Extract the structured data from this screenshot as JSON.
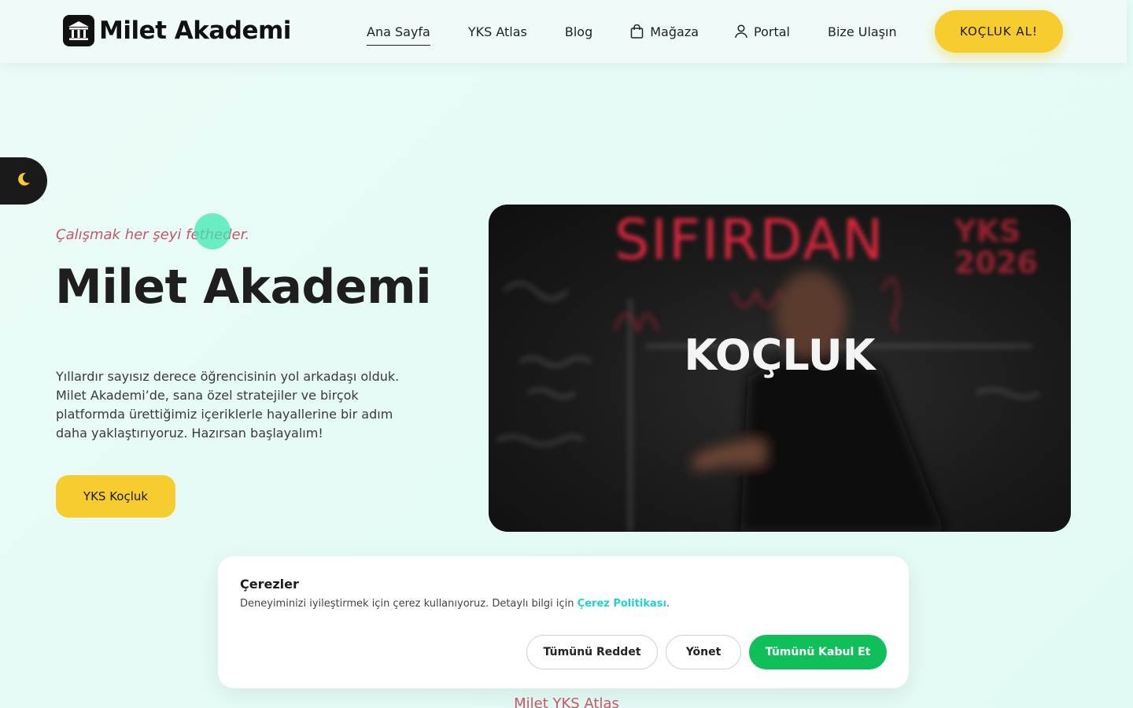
{
  "brand": {
    "name": "Milet Akademi"
  },
  "nav": {
    "items": [
      {
        "label": "Ana Sayfa",
        "icon": ""
      },
      {
        "label": "YKS Atlas",
        "icon": ""
      },
      {
        "label": "Blog",
        "icon": ""
      },
      {
        "label": "Mağaza",
        "icon": "shopping-bag-icon"
      },
      {
        "label": "Portal",
        "icon": "user-icon"
      },
      {
        "label": "Bize Ulaşın",
        "icon": ""
      }
    ],
    "active": "Ana Sayfa",
    "cta_label": "KOÇLUK AL!"
  },
  "theme_toggle": {
    "icon": "moon-icon"
  },
  "hero": {
    "tagline": "Çalışmak her şeyi fetheder.",
    "title": "Milet Akademi",
    "description": "Yıllardır sayısız derece öğrencisinin yol arkadaşı olduk. Milet Akademi’de, sana özel stratejiler ve birçok platformda ürettiğimiz içeriklerle hayallerine bir adım daha yaklaştırıyoruz. Hazırsan başlayalım!",
    "cta_label": "YKS Koçluk"
  },
  "media": {
    "label": "KOÇLUK",
    "board_heading": "SIFIRDAN",
    "board_year": "YKS 2026"
  },
  "cookie_banner": {
    "title": "Çerezler",
    "text": "Deneyiminizi iyileştirmek için çerez kullanıyoruz. Detaylı bilgi için",
    "link_label": "Çerez Politikası",
    "text_end": ".",
    "reject_label": "Tümünü Reddet",
    "manage_label": "Yönet",
    "accept_label": "Tümünü Kabul Et"
  },
  "next_section": {
    "title": "Milet YKS Atlas"
  },
  "colors": {
    "accent_yellow": "#f7cc2e",
    "tagline_pink": "#c4576a",
    "accept_green": "#0fbf5a",
    "link_cyan": "#1fd3d0"
  }
}
